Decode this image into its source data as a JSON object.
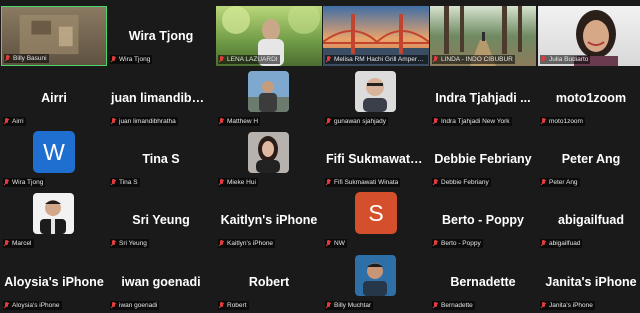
{
  "participants": [
    {
      "name": "Billy Basuni",
      "display_name": "",
      "kind": "video",
      "active": true
    },
    {
      "name": "Wira Tjong",
      "display_name": "Wira Tjong",
      "kind": "name"
    },
    {
      "name": "LENA LAZUARDI",
      "display_name": "",
      "kind": "video"
    },
    {
      "name": "Melisa RM Hachi Grill Ampera ...",
      "display_name": "",
      "kind": "video"
    },
    {
      "name": "LINDA - INDO CIBUBUR",
      "display_name": "",
      "kind": "video"
    },
    {
      "name": "Julia Budiarto",
      "display_name": "",
      "kind": "video"
    },
    {
      "name": "Airri",
      "display_name": "Airri",
      "kind": "name"
    },
    {
      "name": "juan limandibhratha",
      "display_name": "juan  limandibhr...",
      "kind": "name"
    },
    {
      "name": "Matthew H",
      "display_name": "",
      "kind": "photo"
    },
    {
      "name": "gunawan sjahjady",
      "display_name": "",
      "kind": "photo"
    },
    {
      "name": "Indra Tjahjadi New York",
      "display_name": "Indra  Tjahjadi ...",
      "kind": "name"
    },
    {
      "name": "moto1zoom",
      "display_name": "moto1zoom",
      "kind": "name"
    },
    {
      "name": "Wira Tjong",
      "display_name": "",
      "kind": "avatar",
      "initial": "W",
      "color": "#1f6fd1"
    },
    {
      "name": "Tina S",
      "display_name": "Tina S",
      "kind": "name"
    },
    {
      "name": "Mieke Hui",
      "display_name": "",
      "kind": "photo"
    },
    {
      "name": "Fifi Sukmawati Winata",
      "display_name": "Fifi  Sukmawati ...",
      "kind": "name"
    },
    {
      "name": "Debbie Febriany",
      "display_name": "Debbie Febriany",
      "kind": "name"
    },
    {
      "name": "Peter Ang",
      "display_name": "Peter Ang",
      "kind": "name"
    },
    {
      "name": "Marcel",
      "display_name": "",
      "kind": "photo"
    },
    {
      "name": "Sri Yeung",
      "display_name": "Sri Yeung",
      "kind": "name"
    },
    {
      "name": "Kaitlyn's iPhone",
      "display_name": "Kaitlyn's iPhone",
      "kind": "name"
    },
    {
      "name": "NW",
      "display_name": "",
      "kind": "avatar",
      "initial": "S",
      "color": "#d4502c"
    },
    {
      "name": "Berto - Poppy",
      "display_name": "Berto - Poppy",
      "kind": "name"
    },
    {
      "name": "abigailfuad",
      "display_name": "abigailfuad",
      "kind": "name"
    },
    {
      "name": "Aloysia's iPhone",
      "display_name": "Aloysia's iPhone",
      "kind": "name"
    },
    {
      "name": "iwan goenadi",
      "display_name": "iwan goenadi",
      "kind": "name"
    },
    {
      "name": "Robert",
      "display_name": "Robert",
      "kind": "name"
    },
    {
      "name": "Billy Muchtar",
      "display_name": "",
      "kind": "photo"
    },
    {
      "name": "Bernadette",
      "display_name": "Bernadette",
      "kind": "name"
    },
    {
      "name": "Janita's iPhone",
      "display_name": "Janita's iPhone",
      "kind": "name"
    }
  ],
  "colors": {
    "background": "#1a1a1a",
    "active_border": "#4bd66b",
    "muted_mic": "#e23c3c"
  }
}
